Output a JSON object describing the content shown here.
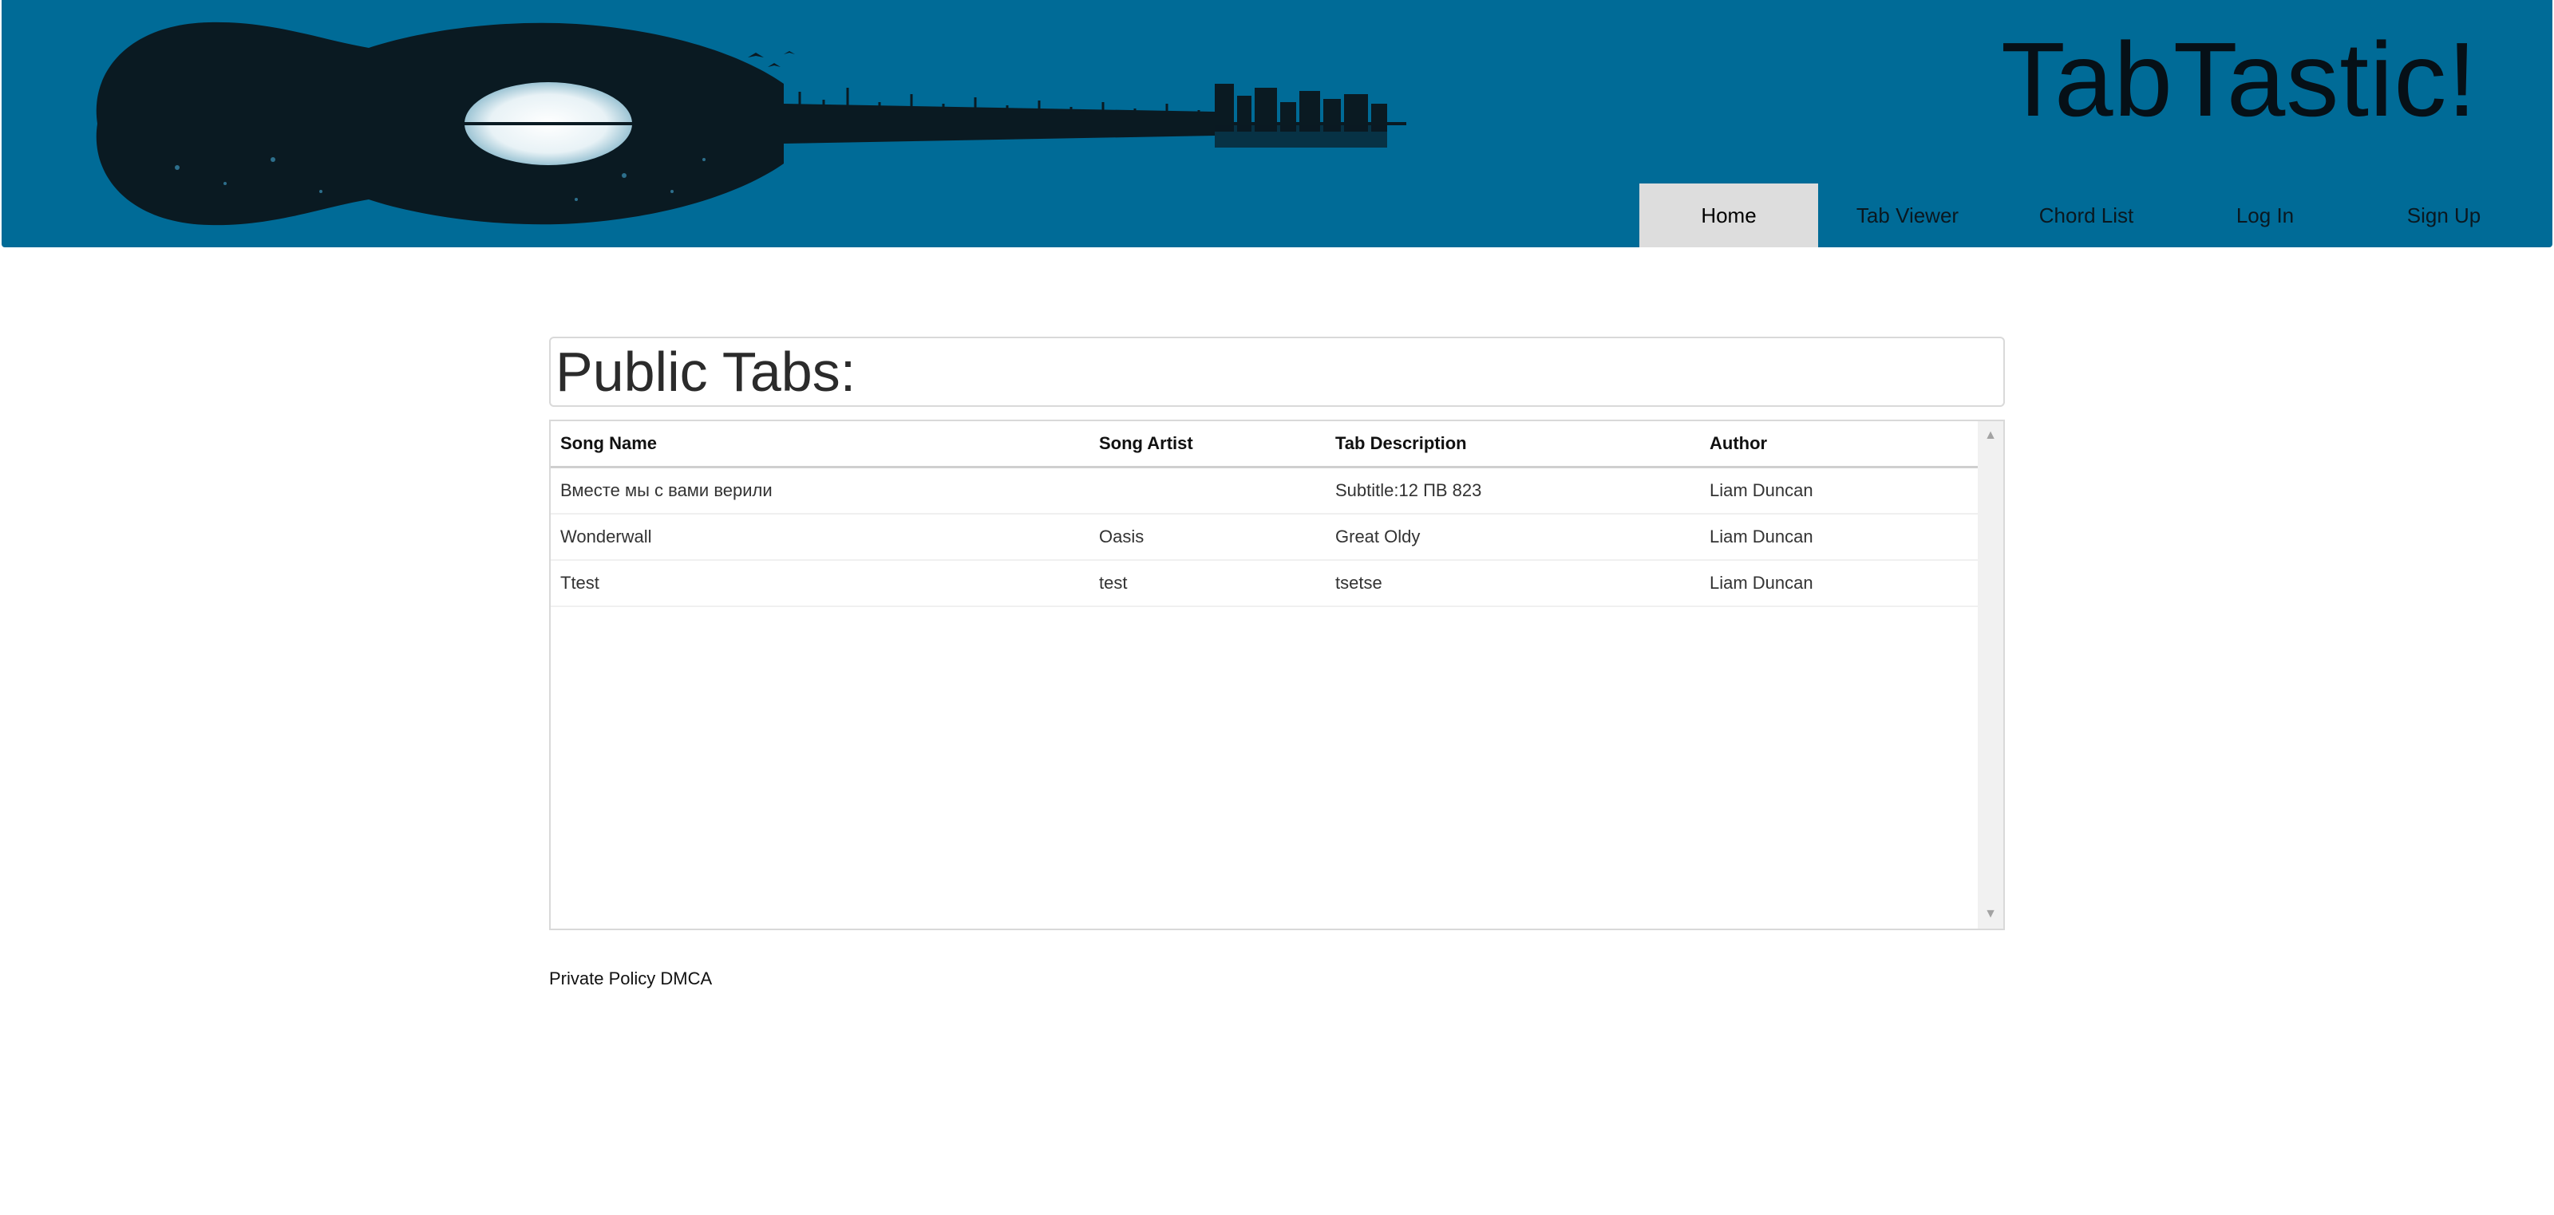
{
  "header": {
    "site_title": "TabTastic!",
    "background_color": "#006b97"
  },
  "nav": {
    "items": [
      {
        "label": "Home",
        "active": true
      },
      {
        "label": "Tab Viewer",
        "active": false
      },
      {
        "label": "Chord List",
        "active": false
      },
      {
        "label": "Log In",
        "active": false
      },
      {
        "label": "Sign Up",
        "active": false
      }
    ]
  },
  "main": {
    "heading": "Public Tabs:",
    "table": {
      "columns": [
        "Song Name",
        "Song Artist",
        "Tab Description",
        "Author"
      ],
      "rows": [
        [
          "Вместе мы с вами верили",
          "",
          "Subtitle:12 ПВ 823",
          "Liam Duncan"
        ],
        [
          "Wonderwall",
          "Oasis",
          "Great Oldy",
          "Liam Duncan"
        ],
        [
          "Ttest",
          "test",
          "tsetse",
          "Liam Duncan"
        ]
      ]
    }
  },
  "footer": {
    "privacy_label": "Private Policy",
    "dmca_label": "DMCA"
  },
  "icons": {
    "scroll_up": "triangle-up-icon",
    "scroll_down": "triangle-down-icon"
  }
}
